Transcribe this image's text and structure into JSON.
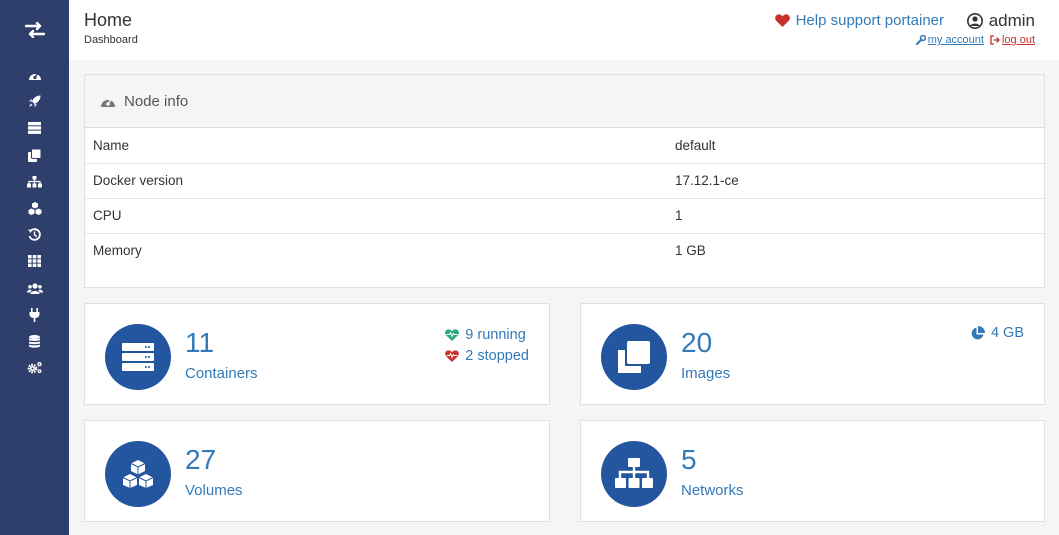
{
  "sidebar": {
    "logo_icon": "swap-arrows-icon",
    "items": [
      {
        "name": "home",
        "icon": "dashboard-gauge-icon"
      },
      {
        "name": "app-templates",
        "icon": "rocket-icon"
      },
      {
        "name": "containers",
        "icon": "server-icon"
      },
      {
        "name": "images",
        "icon": "clone-icon"
      },
      {
        "name": "networks",
        "icon": "sitemap-icon"
      },
      {
        "name": "volumes",
        "icon": "cubes-icon"
      },
      {
        "name": "events",
        "icon": "history-icon"
      },
      {
        "name": "engine",
        "icon": "grid-icon"
      },
      {
        "name": "users",
        "icon": "users-icon"
      },
      {
        "name": "endpoints",
        "icon": "plug-icon"
      },
      {
        "name": "registries",
        "icon": "database-icon"
      },
      {
        "name": "settings",
        "icon": "cogs-icon"
      }
    ]
  },
  "header": {
    "title": "Home",
    "subtitle": "Dashboard",
    "support_label": "Help support portainer",
    "username": "admin",
    "my_account": "my account",
    "log_out": "log out"
  },
  "node_info": {
    "title": "Node info",
    "rows": [
      {
        "key": "Name",
        "value": "default"
      },
      {
        "key": "Docker version",
        "value": "17.12.1-ce"
      },
      {
        "key": "CPU",
        "value": "1"
      },
      {
        "key": "Memory",
        "value": "1 GB"
      }
    ]
  },
  "widgets": {
    "containers": {
      "count": "11",
      "label": "Containers",
      "running": "9 running",
      "stopped": "2 stopped"
    },
    "images": {
      "count": "20",
      "label": "Images",
      "size": "4 GB"
    },
    "volumes": {
      "count": "27",
      "label": "Volumes"
    },
    "networks": {
      "count": "5",
      "label": "Networks"
    }
  },
  "colors": {
    "sidebar_bg": "#2e3f6b",
    "accent": "#337ab7",
    "circle_bg": "#23569e",
    "heart_red": "#c9302c",
    "running_green": "#2aa877"
  }
}
